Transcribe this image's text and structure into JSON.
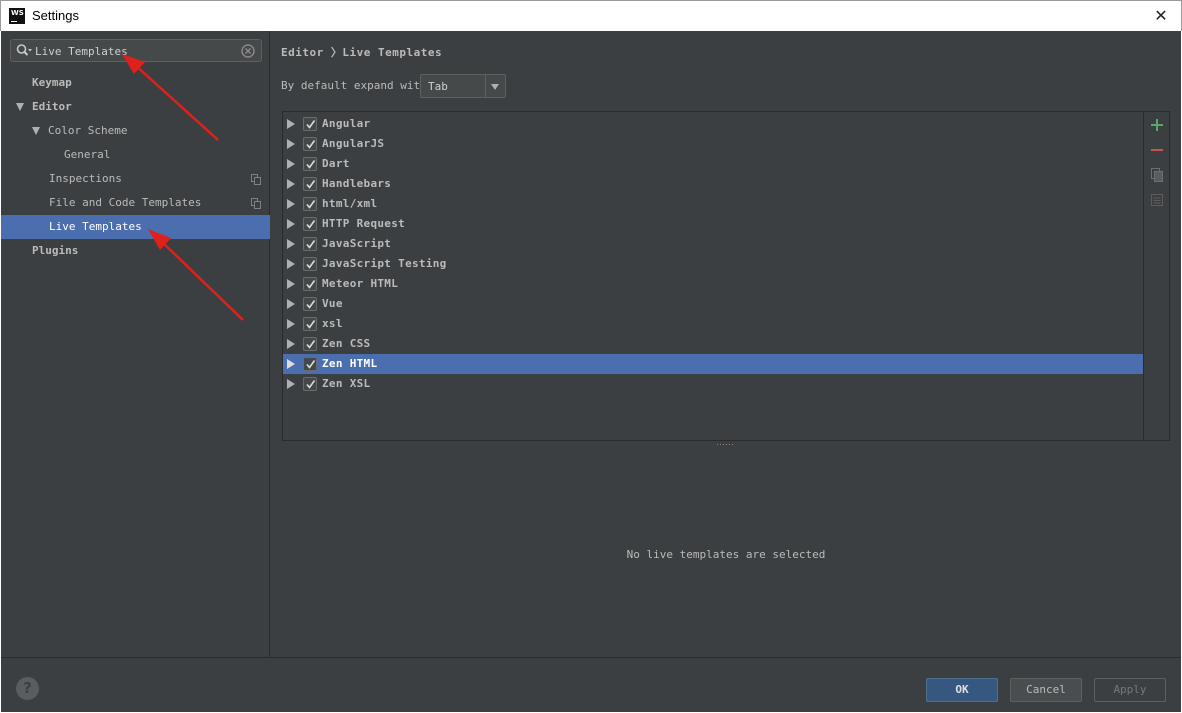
{
  "window": {
    "title": "Settings",
    "app_icon_text": "WS",
    "close_glyph": "✕"
  },
  "search": {
    "value": "Live Templates",
    "placeholder": ""
  },
  "sidebar": {
    "items": [
      {
        "label": "Keymap"
      },
      {
        "label": "Editor"
      },
      {
        "label": "Color Scheme"
      },
      {
        "label": "General"
      },
      {
        "label": "Inspections"
      },
      {
        "label": "File and Code Templates"
      },
      {
        "label": "Live Templates"
      },
      {
        "label": "Plugins"
      }
    ]
  },
  "content": {
    "breadcrumb": "Editor 〉Live Templates",
    "expand_label": "By default expand with",
    "expand_value": "Tab",
    "template_groups": [
      {
        "label": "Angular"
      },
      {
        "label": "AngularJS"
      },
      {
        "label": "Dart"
      },
      {
        "label": "Handlebars"
      },
      {
        "label": "html/xml"
      },
      {
        "label": "HTTP Request"
      },
      {
        "label": "JavaScript"
      },
      {
        "label": "JavaScript Testing"
      },
      {
        "label": "Meteor HTML"
      },
      {
        "label": "Vue"
      },
      {
        "label": "xsl"
      },
      {
        "label": "Zen CSS"
      },
      {
        "label": "Zen HTML"
      },
      {
        "label": "Zen XSL"
      }
    ],
    "selected_group": "Zen HTML",
    "empty_message": "No live templates are selected"
  },
  "footer": {
    "help_glyph": "?",
    "ok_label": "OK",
    "cancel_label": "Cancel",
    "apply_label": "Apply"
  },
  "colors": {
    "background": "#3c3f41",
    "selection": "#4b6eaf",
    "add_icon": "#59a869",
    "remove_icon": "#c75450",
    "annotation_arrow": "#e0201b"
  },
  "icons": [
    "search-icon",
    "clear-search-icon",
    "copy-icon",
    "add-icon",
    "remove-icon",
    "duplicate-icon",
    "edit-icon",
    "help-icon",
    "close-icon"
  ]
}
